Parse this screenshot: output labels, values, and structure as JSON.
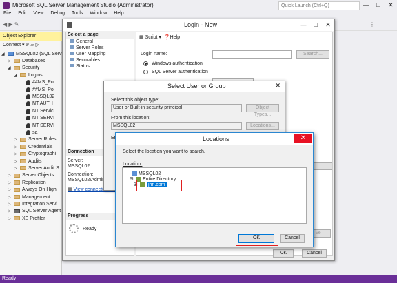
{
  "ssms": {
    "title": "Microsoft SQL Server Management Studio (Administrator)",
    "quick_launch_placeholder": "Quick Launch (Ctrl+Q)",
    "menu": [
      "File",
      "Edit",
      "View",
      "Debug",
      "Tools",
      "Window",
      "Help"
    ],
    "status": "Ready"
  },
  "object_explorer": {
    "title": "Object Explorer",
    "connect_label": "Connect",
    "tree": [
      {
        "label": "MSSQL02 (SQL Server",
        "kind": "server",
        "indent": 0,
        "exp": "◢"
      },
      {
        "label": "Databases",
        "kind": "folder",
        "indent": 1,
        "exp": "▷"
      },
      {
        "label": "Security",
        "kind": "folder",
        "indent": 1,
        "exp": "◢"
      },
      {
        "label": "Logins",
        "kind": "folder",
        "indent": 2,
        "exp": "◢"
      },
      {
        "label": "##MS_Po",
        "kind": "login",
        "indent": 3,
        "exp": ""
      },
      {
        "label": "##MS_Po",
        "kind": "login",
        "indent": 3,
        "exp": ""
      },
      {
        "label": "MSSQL02",
        "kind": "login",
        "indent": 3,
        "exp": ""
      },
      {
        "label": "NT AUTH",
        "kind": "login",
        "indent": 3,
        "exp": ""
      },
      {
        "label": "NT Servic",
        "kind": "login",
        "indent": 3,
        "exp": ""
      },
      {
        "label": "NT SERVI",
        "kind": "login",
        "indent": 3,
        "exp": ""
      },
      {
        "label": "NT SERVI",
        "kind": "login",
        "indent": 3,
        "exp": ""
      },
      {
        "label": "sa",
        "kind": "login",
        "indent": 3,
        "exp": ""
      },
      {
        "label": "Server Roles",
        "kind": "folder",
        "indent": 2,
        "exp": "▷"
      },
      {
        "label": "Credentials",
        "kind": "folder",
        "indent": 2,
        "exp": "▷"
      },
      {
        "label": "Cryptographi",
        "kind": "folder",
        "indent": 2,
        "exp": "▷"
      },
      {
        "label": "Audits",
        "kind": "folder",
        "indent": 2,
        "exp": "▷"
      },
      {
        "label": "Server Audit S",
        "kind": "folder",
        "indent": 2,
        "exp": "▷"
      },
      {
        "label": "Server Objects",
        "kind": "folder",
        "indent": 1,
        "exp": "▷"
      },
      {
        "label": "Replication",
        "kind": "folder",
        "indent": 1,
        "exp": "▷"
      },
      {
        "label": "Always On High",
        "kind": "folder",
        "indent": 1,
        "exp": "▷"
      },
      {
        "label": "Management",
        "kind": "folder",
        "indent": 1,
        "exp": "▷"
      },
      {
        "label": "Integration Servi",
        "kind": "folder",
        "indent": 1,
        "exp": "▷"
      },
      {
        "label": "SQL Server Agent",
        "kind": "agent",
        "indent": 1,
        "exp": "▷"
      },
      {
        "label": "XE Profiler",
        "kind": "folder",
        "indent": 1,
        "exp": "▷"
      }
    ]
  },
  "login_new": {
    "title": "Login - New",
    "select_page": "Select a page",
    "pages": [
      "General",
      "Server Roles",
      "User Mapping",
      "Securables",
      "Status"
    ],
    "script_label": "Script",
    "help_label": "Help",
    "login_name_label": "Login name:",
    "search_button": "Search...",
    "windows_auth": "Windows authentication",
    "sql_auth": "SQL Server authentication",
    "connection_header": "Connection",
    "server_label": "Server:",
    "server_value": "MSSQL02",
    "connection_label": "Connection:",
    "connection_value": "MSSQL02\\Administ",
    "view_conn_link": "View connection pro",
    "progress_header": "Progress",
    "progress_status": "Ready",
    "ok": "OK",
    "cancel": "Cancel",
    "remove_fragment": "ve"
  },
  "select_user": {
    "title": "Select User or Group",
    "object_type_label": "Select this object type:",
    "object_type_value": "User or Built-in security principal",
    "object_types_button": "Object Types...",
    "location_label": "From this location:",
    "location_value": "MSSQL02",
    "locations_button": "Locations...",
    "enter_fragment": "Ent"
  },
  "locations": {
    "title": "Locations",
    "instruction": "Select the location you want to search.",
    "location_label": "Location:",
    "tree": [
      {
        "label": "MSSQL02",
        "exp": "",
        "indent": 0
      },
      {
        "label": "Entire Directory",
        "exp": "⊟",
        "indent": 1
      },
      {
        "label": "jhn.com",
        "exp": "⊞",
        "indent": 2,
        "selected": true
      }
    ],
    "ok": "OK",
    "cancel": "Cancel"
  },
  "colors": {
    "accent": "#0078d7",
    "status_bar": "#6a2f98",
    "oe_header": "#fff29d",
    "highlight_box": "#e02020"
  }
}
